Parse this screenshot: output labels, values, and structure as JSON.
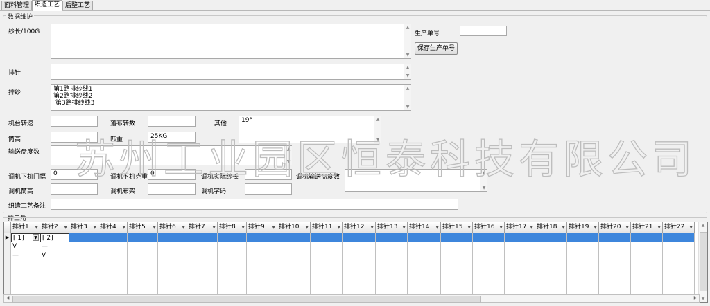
{
  "tabs": [
    "面料管理",
    "织造工艺",
    "后整工艺"
  ],
  "group_title": "数据维护",
  "fields": {
    "sha_chang": {
      "label": "纱长/100G",
      "value": ""
    },
    "pai_zhen": {
      "label": "排针",
      "value": ""
    },
    "pai_sha": {
      "label": "排纱",
      "value": "第1路排纱线1\n第2路排纱线2\n 第3路排纱线3"
    },
    "ji_tai_zhuan_su": {
      "label": "机台转速",
      "value": ""
    },
    "luo_bu_zhuan_shu": {
      "label": "落布转数",
      "value": ""
    },
    "qi_ta": {
      "label": "其他",
      "value": "19°"
    },
    "tong_gao": {
      "label": "筒高",
      "value": ""
    },
    "pi_zhong": {
      "label": "匹重",
      "value": "25KG"
    },
    "shu_song_pan_du_shu": {
      "label": "输送盘度数",
      "value": ""
    },
    "tiao_ji_xia_ji_men_fu": {
      "label": "调机下机门幅",
      "value": "0"
    },
    "tiao_ji_xia_ji_ke_zhong": {
      "label": "调机下机克重",
      "value": "0"
    },
    "tiao_ji_shi_ji_sha_chang": {
      "label": "调机实际纱长",
      "value": ""
    },
    "tiao_ji_shu_song_pan_du_shu": {
      "label": "调机输送盘度数",
      "value": ""
    },
    "tiao_ji_tong_gao": {
      "label": "调机筒高",
      "value": ""
    },
    "tiao_ji_bu_jia": {
      "label": "调机布架",
      "value": ""
    },
    "tiao_ji_zi_ma": {
      "label": "调机字码",
      "value": ""
    },
    "zhi_zao_gong_yi_bei_zhu": {
      "label": "织造工艺备注",
      "value": ""
    }
  },
  "production": {
    "label": "生产单号",
    "value": "",
    "save_button": "保存生产单号"
  },
  "watermark": "苏州工业园区恒泰科技有限公司",
  "triangle": {
    "title": "排三角",
    "columns": [
      "排针1",
      "排针2",
      "排针3",
      "排针4",
      "排针5",
      "排针6",
      "排针7",
      "排针8",
      "排针9",
      "排针10",
      "排针11",
      "排针12",
      "排针13",
      "排针14",
      "排针15",
      "排针16",
      "排针17",
      "排针18",
      "排针19",
      "排针20",
      "排针21",
      "排针22"
    ],
    "rows": [
      [
        "[ 1]",
        "[ 2]"
      ],
      [
        "V",
        "—"
      ],
      [
        "—",
        "V"
      ],
      [],
      [],
      [],
      []
    ]
  }
}
